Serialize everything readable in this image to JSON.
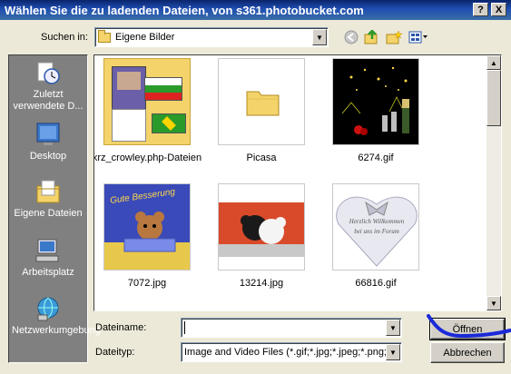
{
  "window": {
    "title": "Wählen Sie die zu ladenden Dateien, von s361.photobucket.com",
    "help_label": "?",
    "close_label": "X"
  },
  "lookin": {
    "label": "Suchen in:",
    "value": "Eigene Bilder"
  },
  "toolbar": {
    "back_icon": "back-icon",
    "up_icon": "up-folder-icon",
    "new_folder_icon": "new-folder-icon",
    "views_icon": "views-menu-icon"
  },
  "places": [
    {
      "label": "Zuletzt verwendete D...",
      "icon": "recent-icon"
    },
    {
      "label": "Desktop",
      "icon": "desktop-icon"
    },
    {
      "label": "Eigene Dateien",
      "icon": "my-documents-icon"
    },
    {
      "label": "Arbeitsplatz",
      "icon": "my-computer-icon"
    },
    {
      "label": "Netzwerkumgebung",
      "icon": "network-icon"
    }
  ],
  "files": [
    {
      "name": "krz_crowley.php-Dateien"
    },
    {
      "name": "Picasa"
    },
    {
      "name": "6274.gif"
    },
    {
      "name": "7072.jpg",
      "caption": "Gute Besserung"
    },
    {
      "name": "13214.jpg"
    },
    {
      "name": "66816.gif",
      "caption": "Herzlich Willkommen bei uns im Forum"
    }
  ],
  "bottom": {
    "filename_label": "Dateiname:",
    "filename_value": "",
    "filetype_label": "Dateityp:",
    "filetype_value": "Image and Video Files (*.gif;*.jpg;*.jpeg;*.png;*.bmp)",
    "open_label": "Öffnen",
    "cancel_label": "Abbrechen"
  }
}
